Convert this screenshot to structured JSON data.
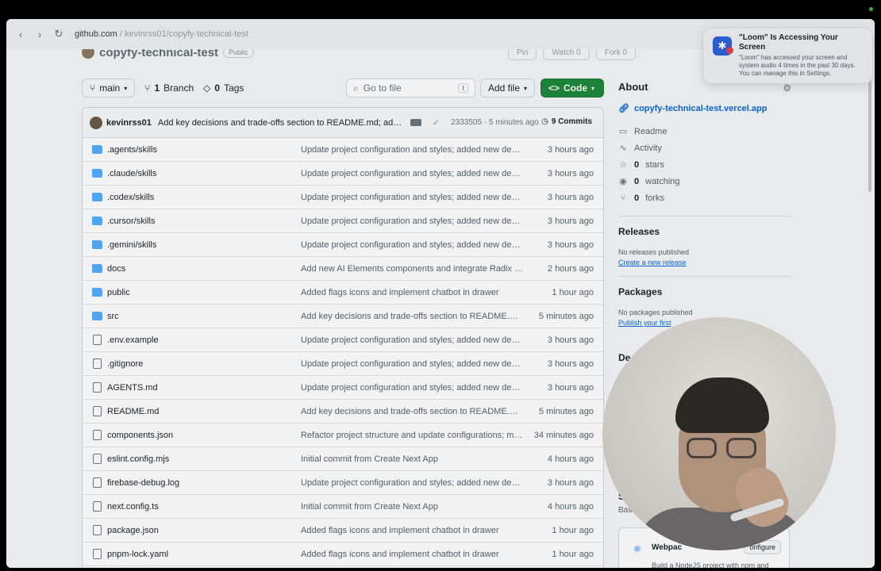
{
  "browser": {
    "url_domain": "github.com",
    "url_path": " / kevinrss01/copyfy-technical-test"
  },
  "repo": {
    "name": "copyfy-technical-test",
    "visibility": "Public",
    "actions": [
      "Pin",
      "Watch 0",
      "Fork 0"
    ]
  },
  "toolbar": {
    "branch": "main",
    "branch_count": "1",
    "branch_label": "Branch",
    "tag_count": "0",
    "tag_label": "Tags",
    "goto_placeholder": "Go to file",
    "goto_kbd": "t",
    "add_file": "Add file",
    "code": "Code"
  },
  "commit": {
    "author": "kevinrss01",
    "message": "Add key decisions and trade-offs section to README.md; adjus...",
    "meta": "2333505 · 5 minutes ago",
    "commits_label": "9 Commits"
  },
  "files": [
    {
      "name": ".agents/skills",
      "type": "folder",
      "message": "Update project configuration and styles; added new depe...",
      "when": "3 hours ago"
    },
    {
      "name": ".claude/skills",
      "type": "folder",
      "message": "Update project configuration and styles; added new depe...",
      "when": "3 hours ago"
    },
    {
      "name": ".codex/skills",
      "type": "folder",
      "message": "Update project configuration and styles; added new depe...",
      "when": "3 hours ago"
    },
    {
      "name": ".cursor/skills",
      "type": "folder",
      "message": "Update project configuration and styles; added new depe...",
      "when": "3 hours ago"
    },
    {
      "name": ".gemini/skills",
      "type": "folder",
      "message": "Update project configuration and styles; added new depe...",
      "when": "3 hours ago"
    },
    {
      "name": "docs",
      "type": "folder",
      "message": "Add new AI Elements components and integrate Radix UI ...",
      "when": "2 hours ago"
    },
    {
      "name": "public",
      "type": "folder",
      "message": "Added flags icons and implement chatbot in drawer",
      "when": "1 hour ago"
    },
    {
      "name": "src",
      "type": "folder",
      "message": "Add key decisions and trade-offs section to README.md;...",
      "when": "5 minutes ago"
    },
    {
      "name": ".env.example",
      "type": "file",
      "message": "Update project configuration and styles; added new depe...",
      "when": "3 hours ago"
    },
    {
      "name": ".gitignore",
      "type": "file",
      "message": "Update project configuration and styles; added new depe...",
      "when": "3 hours ago"
    },
    {
      "name": "AGENTS.md",
      "type": "file",
      "message": "Update project configuration and styles; added new depe...",
      "when": "3 hours ago"
    },
    {
      "name": "README.md",
      "type": "file",
      "message": "Add key decisions and trade-offs section to README.md;...",
      "when": "5 minutes ago"
    },
    {
      "name": "components.json",
      "type": "file",
      "message": "Refactor project structure and update configurations; mo...",
      "when": "34 minutes ago"
    },
    {
      "name": "eslint.config.mjs",
      "type": "file",
      "message": "Initial commit from Create Next App",
      "when": "4 hours ago"
    },
    {
      "name": "firebase-debug.log",
      "type": "file",
      "message": "Update project configuration and styles; added new depe...",
      "when": "3 hours ago"
    },
    {
      "name": "next.config.ts",
      "type": "file",
      "message": "Initial commit from Create Next App",
      "when": "4 hours ago"
    },
    {
      "name": "package.json",
      "type": "file",
      "message": "Added flags icons and implement chatbot in drawer",
      "when": "1 hour ago"
    },
    {
      "name": "pnpm-lock.yaml",
      "type": "file",
      "message": "Added flags icons and implement chatbot in drawer",
      "when": "1 hour ago"
    }
  ],
  "about": {
    "title": "About",
    "website": "copyfy-technical-test.vercel.app",
    "readme": "Readme",
    "activity": "Activity",
    "stars_count": "0",
    "stars_label": "stars",
    "watching_count": "0",
    "watching_label": "watching",
    "forks_count": "0",
    "forks_label": "forks"
  },
  "releases": {
    "title": "Releases",
    "empty": "No releases published",
    "create": "Create a new release"
  },
  "packages": {
    "title": "Packages",
    "empty": "No packages published",
    "publish": "Publish your first"
  },
  "sidebar_partial": {
    "deployments_prefix": "De",
    "suggested_prefix": "S",
    "suggested_sub": "Bas",
    "card_title": "Webpac",
    "card_button": "onfigure",
    "card_desc": "Build a NodeJS project with npm and"
  },
  "notification": {
    "title": "\"Loom\" Is Accessing Your Screen",
    "body": "\"Loom\" has accessed your screen and system audio 4 times in the past 30 days. You can manage this in Settings."
  }
}
